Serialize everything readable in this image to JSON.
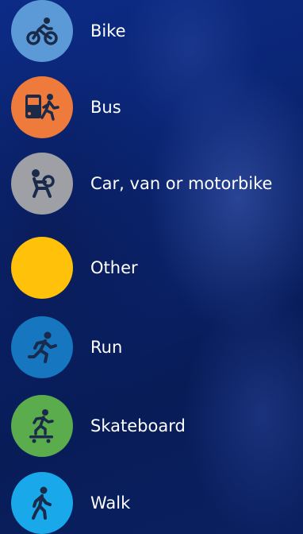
{
  "options": [
    {
      "label": "Bike",
      "icon": "bike-icon",
      "color": "#5b9ad6"
    },
    {
      "label": "Bus",
      "icon": "bus-icon",
      "color": "#ee7a3b"
    },
    {
      "label": "Car, van or motorbike",
      "icon": "car-icon",
      "color": "#9ea0a6"
    },
    {
      "label": "Other",
      "icon": "other-icon",
      "color": "#ffc10a"
    },
    {
      "label": "Run",
      "icon": "run-icon",
      "color": "#1676bf"
    },
    {
      "label": "Skateboard",
      "icon": "skateboard-icon",
      "color": "#5aac4d"
    },
    {
      "label": "Walk",
      "icon": "walk-icon",
      "color": "#19a8ea"
    }
  ]
}
